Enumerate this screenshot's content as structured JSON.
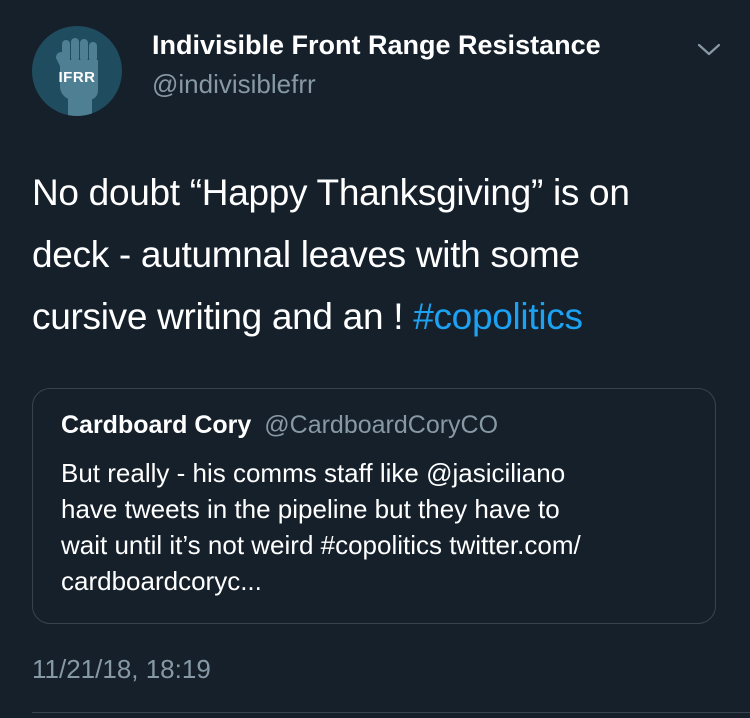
{
  "author": {
    "display_name": "Indivisible Front Range Resistance",
    "handle": "@indivisiblefrr",
    "avatar_text": "IFRR",
    "avatar_icon": "raised-fist-icon",
    "avatar_color": "#1f4d5f"
  },
  "menu": {
    "icon": "chevron-down-icon"
  },
  "tweet": {
    "lines": [
      "No doubt “Happy Thanksgiving” is on",
      "deck - autumnal leaves with some",
      "cursive writing and an ! "
    ],
    "hashtag": "#copolitics"
  },
  "quoted_tweet": {
    "name": "Cardboard Cory",
    "handle": "@CardboardCoryCO",
    "lines": [
      "But really - his comms staff like @jasiciliano",
      "have tweets in the pipeline but they have to",
      "wait until it’s not weird #copolitics twitter.com/",
      "cardboardcoryc..."
    ]
  },
  "timestamp": "11/21/18, 18:19",
  "colors": {
    "background": "#15202b",
    "text": "#ffffff",
    "secondary": "#8899a6",
    "link": "#1da1f2",
    "border": "#38444d"
  }
}
